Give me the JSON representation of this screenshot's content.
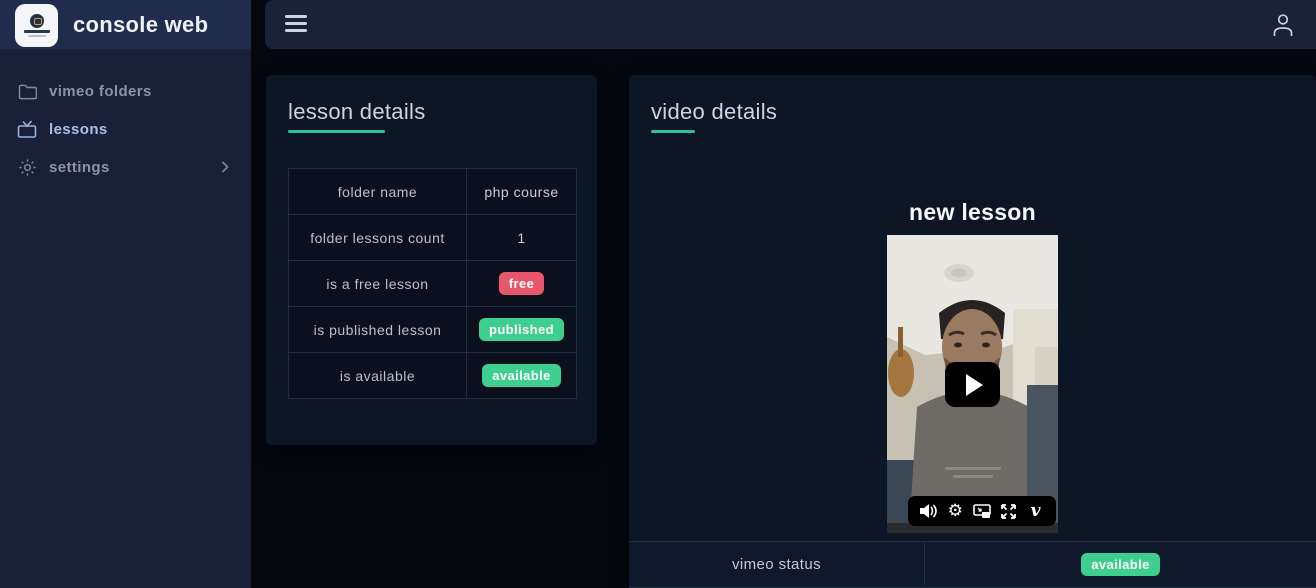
{
  "app": {
    "title": "console web",
    "logo": "brand-logo"
  },
  "topbar": {
    "menu_icon": "hamburger-menu-icon",
    "user_icon": "user-profile-icon"
  },
  "sidebar": {
    "items": [
      {
        "label": "vimeo folders",
        "icon": "folder-icon",
        "active": false
      },
      {
        "label": "lessons",
        "icon": "tv-icon",
        "active": true
      },
      {
        "label": "settings",
        "icon": "gear-icon",
        "active": false,
        "has_submenu": true
      }
    ]
  },
  "lesson_card": {
    "title": "lesson details",
    "rows": [
      {
        "label": "folder name",
        "value": "php course",
        "type": "text"
      },
      {
        "label": "folder lessons count",
        "value": "1",
        "type": "text"
      },
      {
        "label": "is a free lesson",
        "value": "free",
        "type": "badge-red"
      },
      {
        "label": "is published lesson",
        "value": "published",
        "type": "badge-green"
      },
      {
        "label": "is available",
        "value": "available",
        "type": "badge-green"
      }
    ]
  },
  "video_card": {
    "title": "video details",
    "video_title": "new lesson",
    "player": {
      "play_icon": "play-button",
      "controls": [
        "volume-icon",
        "settings-icon",
        "picture-in-picture-icon",
        "fullscreen-icon",
        "vimeo-logo-icon"
      ]
    },
    "status_row": {
      "label": "vimeo status",
      "value": "available",
      "type": "badge-green"
    }
  },
  "colors": {
    "accent_teal": "#2fbf9d",
    "badge_red": "#e8566c",
    "badge_green": "#3ecf8e",
    "sidebar_bg": "#1a2037",
    "sidebar_header_bg": "#1f2c4b",
    "topbar_bg": "#1b2137",
    "card_bg": "#0d1624",
    "page_bg": "#05070f"
  }
}
